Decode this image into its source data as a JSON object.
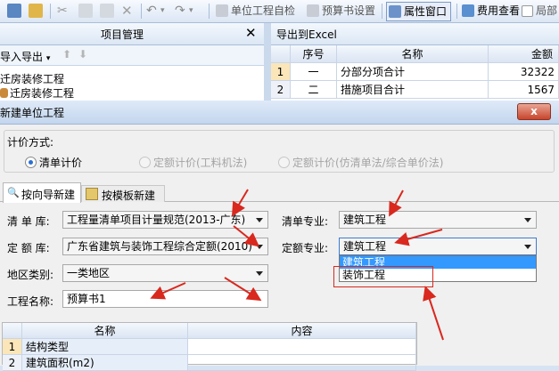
{
  "toolbar": {
    "unit_check": "单位工程自检",
    "budget_settings": "预算书设置",
    "property_window": "属性窗口",
    "fee_view": "费用查看",
    "partial_summary": "局部"
  },
  "left_panel": {
    "title": "项目管理",
    "close": "✕",
    "import_export": "导入导出",
    "tree_items": [
      "迁房装修工程",
      "迁房装修工程"
    ]
  },
  "right_panel": {
    "export_excel": "导出到Excel",
    "columns": [
      "序号",
      "名称",
      "金额"
    ],
    "rows": [
      {
        "num": "1",
        "seq": "一",
        "name": "分部分项合计",
        "amount": "32322"
      },
      {
        "num": "2",
        "seq": "二",
        "name": "措施项目合计",
        "amount": "1567"
      }
    ]
  },
  "dialog": {
    "title": "新建单位工程",
    "close_label": "x",
    "pricing_method_label": "计价方式:",
    "pricing_options": [
      {
        "label": "清单计价",
        "selected": true,
        "enabled": true
      },
      {
        "label": "定额计价(工料机法)",
        "selected": false,
        "enabled": false
      },
      {
        "label": "定额计价(仿清单法/综合单价法)",
        "selected": false,
        "enabled": false
      }
    ],
    "tabs": [
      "按向导新建",
      "按模板新建"
    ],
    "list_library_label": "清 单 库:",
    "list_library_value": "工程量清单项目计量规范(2013-广东)",
    "quota_library_label": "定 额 库:",
    "quota_library_value": "广东省建筑与装饰工程综合定额(2010)",
    "region_label": "地区类别:",
    "region_value": "一类地区",
    "project_name_label": "工程名称:",
    "project_name_value": "预算书1",
    "list_specialty_label": "清单专业:",
    "list_specialty_value": "建筑工程",
    "quota_specialty_label": "定额专业:",
    "quota_specialty_value": "建筑工程",
    "quota_specialty_options": [
      "建筑工程",
      "装饰工程"
    ],
    "table_columns": [
      "名称",
      "内容"
    ],
    "table_rows": [
      {
        "num": "1",
        "name": "结构类型",
        "content": ""
      },
      {
        "num": "2",
        "name": "建筑面积(m2)",
        "content": ""
      }
    ]
  },
  "colors": {
    "annotation_red": "#d9281e",
    "selection_blue": "#3399ff",
    "toolbar_bg": "#dbe6f4"
  }
}
